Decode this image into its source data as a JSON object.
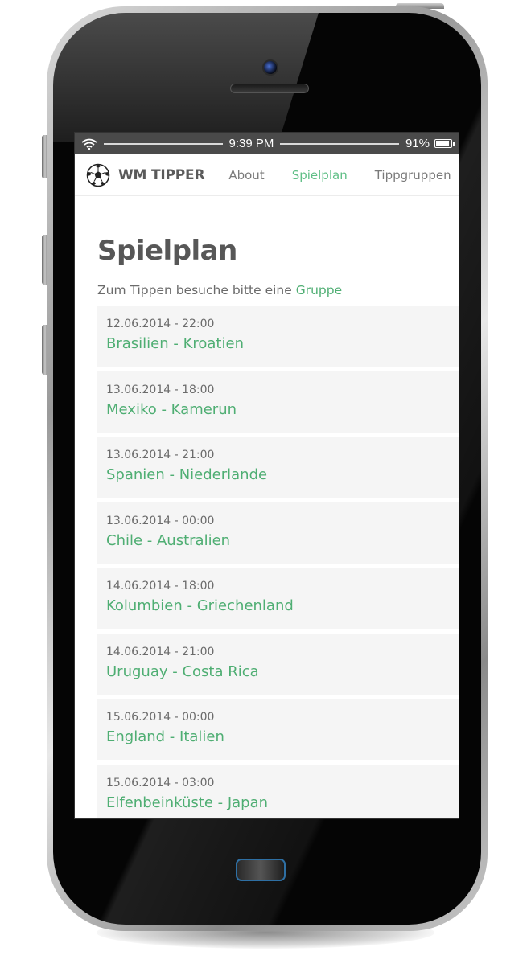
{
  "status_bar": {
    "time": "9:39 PM",
    "battery_percent_text": "91%",
    "battery_level": 0.91,
    "wifi_icon": "wifi-icon"
  },
  "nav": {
    "brand": "WM TIPPER",
    "brand_icon": "soccer-ball-icon",
    "links": [
      {
        "label": "About",
        "active": false
      },
      {
        "label": "Spielplan",
        "active": true
      },
      {
        "label": "Tippgruppen",
        "active": false
      }
    ]
  },
  "page": {
    "title": "Spielplan",
    "hint_prefix": "Zum Tippen besuche bitte eine ",
    "hint_link": "Gruppe"
  },
  "matches": [
    {
      "date": "12.06.2014 - 22:00",
      "teams": "Brasilien - Kroatien"
    },
    {
      "date": "13.06.2014 - 18:00",
      "teams": "Mexiko - Kamerun"
    },
    {
      "date": "13.06.2014 - 21:00",
      "teams": "Spanien - Niederlande"
    },
    {
      "date": "13.06.2014 - 00:00",
      "teams": "Chile - Australien"
    },
    {
      "date": "14.06.2014 - 18:00",
      "teams": "Kolumbien - Griechenland"
    },
    {
      "date": "14.06.2014 - 21:00",
      "teams": "Uruguay - Costa Rica"
    },
    {
      "date": "15.06.2014 - 00:00",
      "teams": "England - Italien"
    },
    {
      "date": "15.06.2014 - 03:00",
      "teams": "Elfenbeinküste - Japan"
    }
  ],
  "colors": {
    "accent": "#4fae73",
    "nav_active": "#5fbf86",
    "title": "#575757",
    "status_bar": "#4a4a4a",
    "card_bg": "#f5f5f5"
  }
}
